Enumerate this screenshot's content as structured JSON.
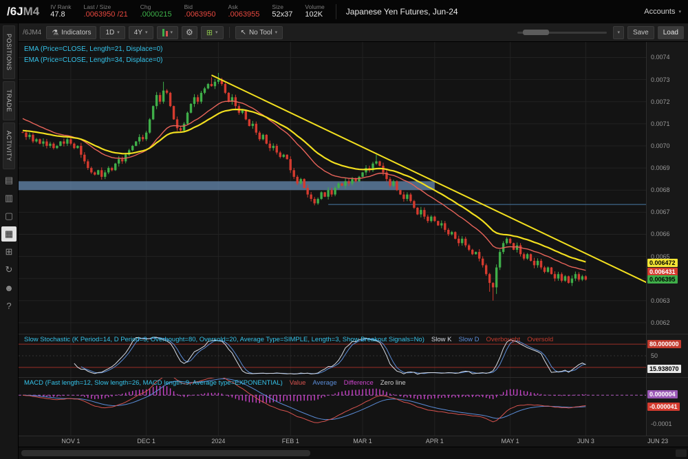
{
  "topbar": {
    "symbol": "/6J",
    "contract": "M4",
    "fields": [
      {
        "label": "IV Rank",
        "value": "47.8",
        "color": "#e6e6e6"
      },
      {
        "label": "Last / Size",
        "value": ".0063950 /21",
        "color": "#e8483f"
      },
      {
        "label": "Chg",
        "value": ".0000215",
        "color": "#3eb24a"
      },
      {
        "label": "Bid",
        "value": ".0063950",
        "color": "#e8483f"
      },
      {
        "label": "Ask",
        "value": ".0063955",
        "color": "#e8483f"
      },
      {
        "label": "Size",
        "value": "52x37",
        "color": "#e6e6e6"
      },
      {
        "label": "Volume",
        "value": "102K",
        "color": "#e6e6e6"
      }
    ],
    "description": "Japanese Yen Futures, Jun-24",
    "accounts_label": "Accounts"
  },
  "sidebar": {
    "tabs": [
      {
        "label": "POSITIONS"
      },
      {
        "label": "TRADE"
      },
      {
        "label": "ACTIVITY"
      }
    ],
    "icons": [
      {
        "name": "ledger-icon",
        "glyph": "▤"
      },
      {
        "name": "orders-icon",
        "glyph": "▥"
      },
      {
        "name": "window-icon",
        "glyph": "▢"
      },
      {
        "name": "chart-icon",
        "glyph": "▦",
        "active": true
      },
      {
        "name": "grid-icon",
        "glyph": "⊞"
      },
      {
        "name": "sync-icon",
        "glyph": "↻"
      },
      {
        "name": "users-icon",
        "glyph": "☻"
      },
      {
        "name": "help-icon",
        "glyph": "?"
      }
    ]
  },
  "toolbar": {
    "symbol_label": "/6JM4",
    "indicators_label": "Indicators",
    "aggregation": "1D",
    "range": "4Y",
    "tool_label": "No Tool",
    "save_label": "Save",
    "load_label": "Load"
  },
  "price_pane": {
    "ema_labels": [
      "EMA (Price=CLOSE, Length=21, Displace=0)",
      "EMA (Price=CLOSE, Length=34, Displace=0)"
    ],
    "axis_ticks": [
      "0.0074",
      "0.0073",
      "0.0072",
      "0.0071",
      "0.0070",
      "0.0069",
      "0.0068",
      "0.0067",
      "0.0066",
      "0.0065",
      "0.0064",
      "0.0063",
      "0.0062"
    ],
    "value_boxes": [
      {
        "text": "0.006472",
        "price": 0.006472,
        "bg": "#f5e636",
        "fg": "#000000"
      },
      {
        "text": "0.006431",
        "price": 0.006431,
        "bg": "#d43b2f",
        "fg": "#ffffff"
      },
      {
        "text": "0.006395",
        "price": 0.006395,
        "bg": "#3fae49",
        "fg": "#000000"
      }
    ]
  },
  "stoch_pane": {
    "label": "Slow Stochastic (K Period=14, D Period=3, Overbought=80, Oversold=20, Average Type=SIMPLE, Length=3, Show Breakout Signals=No)",
    "legend": [
      {
        "text": "Slow K",
        "color": "#d8dde6"
      },
      {
        "text": "Slow D",
        "color": "#5b8dd9"
      },
      {
        "text": "Overbought",
        "color": "#c23b2e"
      },
      {
        "text": "Oversold",
        "color": "#c23b2e"
      }
    ],
    "mid_label": "50",
    "overbought": 80,
    "oversold": 20,
    "value_boxes": [
      {
        "text": "80.000000",
        "value": 80,
        "bg": "#c23b2e",
        "fg": "#ffffff"
      },
      {
        "text": "15.938070",
        "value": 15.93807,
        "bg": "#e8e8e8",
        "fg": "#000000"
      }
    ]
  },
  "macd_pane": {
    "label": "MACD (Fast length=12, Slow length=26, MACD length=9, Average type=EXPONENTIAL)",
    "legend": [
      {
        "text": "Value",
        "color": "#d9534f"
      },
      {
        "text": "Average",
        "color": "#5b8dd9"
      },
      {
        "text": "Difference",
        "color": "#cc44cc"
      },
      {
        "text": "Zero line",
        "color": "#cccccc"
      }
    ],
    "axis_label": "-0.0001",
    "axis_value": -0.0001,
    "value_boxes": [
      {
        "text": "0.000004",
        "value": 4e-06,
        "bg": "#9b59b6",
        "fg": "#ffffff"
      },
      {
        "text": "-0.000041",
        "value": -4.1e-05,
        "bg": "#d43b2f",
        "fg": "#ffffff"
      }
    ]
  },
  "time_axis": {
    "labels": [
      {
        "text": "NOV 1",
        "index": 14
      },
      {
        "text": "DEC 1",
        "index": 36
      },
      {
        "text": "2024",
        "index": 57
      },
      {
        "text": "FEB 1",
        "index": 78
      },
      {
        "text": "MAR 1",
        "index": 99
      },
      {
        "text": "APR 1",
        "index": 120
      },
      {
        "text": "MAY 1",
        "index": 142
      },
      {
        "text": "JUN 3",
        "index": 164
      },
      {
        "text": "JUN 23",
        "index": 185
      }
    ]
  },
  "chart_data": {
    "type": "candlestick",
    "symbol": "/6JM4",
    "title": "Japanese Yen Futures, Jun-24",
    "y_range": [
      0.00615,
      0.00747
    ],
    "up_color": "#3fae49",
    "down_color": "#d43b2f",
    "closes": [
      0.00706,
      0.00704,
      0.00705,
      0.00702,
      0.00703,
      0.00701,
      0.00702,
      0.007,
      0.00701,
      0.00699,
      0.007,
      0.00702,
      0.00701,
      0.00703,
      0.00701,
      0.00699,
      0.007,
      0.00696,
      0.00693,
      0.0069,
      0.00688,
      0.00687,
      0.00689,
      0.00686,
      0.00688,
      0.0069,
      0.00689,
      0.00692,
      0.00694,
      0.00693,
      0.00696,
      0.00698,
      0.007,
      0.00702,
      0.00704,
      0.00703,
      0.00706,
      0.00712,
      0.00718,
      0.00723,
      0.0072,
      0.00725,
      0.00724,
      0.00718,
      0.00712,
      0.00708,
      0.00707,
      0.0071,
      0.00715,
      0.00719,
      0.00722,
      0.0072,
      0.00724,
      0.00726,
      0.00728,
      0.00727,
      0.00729,
      0.0073,
      0.00728,
      0.00724,
      0.0072,
      0.00722,
      0.00718,
      0.00715,
      0.00716,
      0.00712,
      0.00709,
      0.0071,
      0.00706,
      0.00703,
      0.00705,
      0.00701,
      0.00699,
      0.007,
      0.00697,
      0.00695,
      0.00696,
      0.00694,
      0.00689,
      0.00686,
      0.00683,
      0.00685,
      0.00681,
      0.00678,
      0.00676,
      0.00674,
      0.00676,
      0.00679,
      0.00677,
      0.0068,
      0.00678,
      0.00681,
      0.00683,
      0.00682,
      0.00684,
      0.00683,
      0.00685,
      0.00684,
      0.00686,
      0.00688,
      0.0069,
      0.00689,
      0.00692,
      0.00693,
      0.00691,
      0.00688,
      0.00685,
      0.00682,
      0.00684,
      0.0068,
      0.00678,
      0.00676,
      0.00678,
      0.00675,
      0.00672,
      0.00669,
      0.00671,
      0.00668,
      0.00666,
      0.00668,
      0.00666,
      0.00664,
      0.00665,
      0.00662,
      0.0066,
      0.00661,
      0.00658,
      0.00656,
      0.00658,
      0.00655,
      0.00653,
      0.00651,
      0.00652,
      0.00649,
      0.00646,
      0.00642,
      0.00638,
      0.00636,
      0.00645,
      0.00652,
      0.00656,
      0.00658,
      0.00656,
      0.00653,
      0.00655,
      0.00651,
      0.00649,
      0.00651,
      0.00648,
      0.00646,
      0.00648,
      0.00645,
      0.00643,
      0.00645,
      0.00642,
      0.0064,
      0.00642,
      0.00639,
      0.00641,
      0.00638,
      0.0064,
      0.00642,
      0.006395,
      0.00641,
      0.006395
    ],
    "wick_overrides": [
      {
        "index": 41,
        "high": 0.00729
      },
      {
        "index": 55,
        "high": 0.00731
      },
      {
        "index": 57,
        "high": 0.00733
      },
      {
        "index": 103,
        "high": 0.00696
      },
      {
        "index": 136,
        "low": 0.00634
      },
      {
        "index": 137,
        "low": 0.0063
      },
      {
        "index": 138,
        "low": 0.00633
      }
    ],
    "overlays": {
      "ema21_color": "#e8645a",
      "ema34_color": "#f2df1f",
      "trendline": {
        "from_index": 55,
        "from_price": 0.00732,
        "to_index": 182,
        "to_price": 0.00638,
        "color": "#f2df1f"
      },
      "zone": {
        "from_index": -2,
        "to_index": 120,
        "top": 0.00684,
        "bottom": 0.0068,
        "color": "rgba(96,130,166,0.8)"
      },
      "hline": {
        "from_index": 89,
        "price": 0.006735,
        "color": "#4a7ba6"
      }
    },
    "indicators": {
      "ema": [
        {
          "length": 21
        },
        {
          "length": 34
        }
      ],
      "slow_stochastic": {
        "k_period": 14,
        "d_period": 3,
        "overbought": 80,
        "oversold": 20,
        "last_k": 15.93807
      },
      "macd": {
        "fast": 12,
        "slow": 26,
        "length": 9,
        "last_value": -4.1e-05,
        "last_difference": 4e-06
      }
    }
  }
}
